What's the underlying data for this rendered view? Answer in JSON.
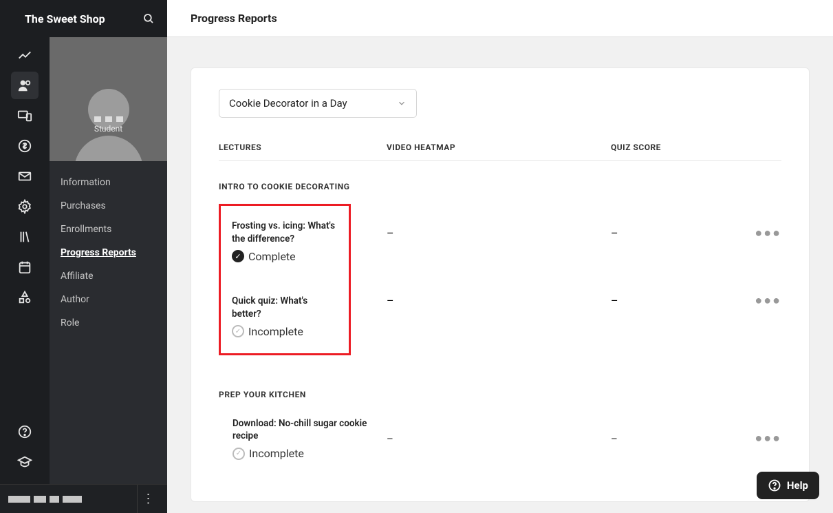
{
  "brand": "The Sweet Shop",
  "page_title": "Progress Reports",
  "profile": {
    "role": "Student"
  },
  "sub_nav": [
    {
      "label": "Information"
    },
    {
      "label": "Purchases"
    },
    {
      "label": "Enrollments"
    },
    {
      "label": "Progress Reports",
      "active": true
    },
    {
      "label": "Affiliate"
    },
    {
      "label": "Author"
    },
    {
      "label": "Role"
    }
  ],
  "dropdown": {
    "selected": "Cookie Decorator in a Day"
  },
  "columns": {
    "lectures": "LECTURES",
    "video": "VIDEO HEATMAP",
    "quiz": "QUIZ SCORE"
  },
  "sections": [
    {
      "title": "INTRO TO COOKIE DECORATING",
      "highlighted": true,
      "lectures": [
        {
          "title": "Frosting vs. icing: What's the difference?",
          "status": "Complete",
          "complete": true,
          "video": "–",
          "quiz": "–"
        },
        {
          "title": "Quick quiz: What's better?",
          "status": "Incomplete",
          "complete": false,
          "video": "–",
          "quiz": "–"
        }
      ]
    },
    {
      "title": "PREP YOUR KITCHEN",
      "highlighted": false,
      "lectures": [
        {
          "title": "Download: No-chill sugar cookie recipe",
          "status": "Incomplete",
          "complete": false,
          "video": "–",
          "quiz": "–"
        }
      ]
    }
  ],
  "help": {
    "label": "Help"
  }
}
